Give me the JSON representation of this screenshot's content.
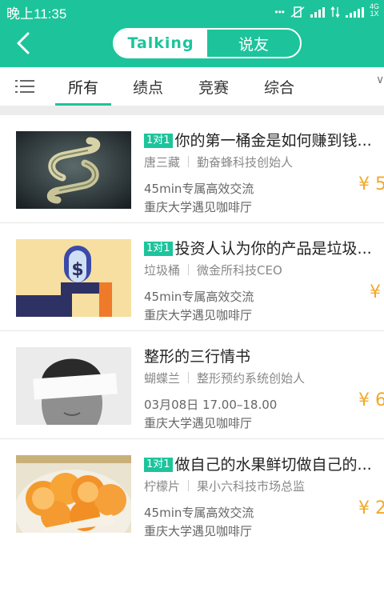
{
  "status": {
    "time": "晚上11:35",
    "dots": "•••",
    "net_label": "4G",
    "net_sub": "1X"
  },
  "header": {
    "tabs": [
      "Talking",
      "说友"
    ]
  },
  "category_tabs": [
    "所有",
    "绩点",
    "竞赛",
    "综合"
  ],
  "tab_more": "∨",
  "colors": {
    "accent": "#1dc49b",
    "price": "#f3a82a"
  },
  "cards": [
    {
      "badge": "1对1",
      "title": "你的第一桶金是如何赚到钱...",
      "name": "唐三藏",
      "role": "勤奋蜂科技创始人",
      "line1": "45min专属高效交流",
      "line2": "重庆大学遇见咖啡厅",
      "price": "¥ 5"
    },
    {
      "badge": "1对1",
      "title": "投资人认为你的产品是垃圾...",
      "name": "垃圾桶",
      "role": "微金所科技CEO",
      "line1": "45min专属高效交流",
      "line2": "重庆大学遇见咖啡厅",
      "price": "¥"
    },
    {
      "badge": "",
      "title": "整形的三行情书",
      "name": "蝴蝶兰",
      "role": "整形预约系统创始人",
      "line1": "03月08日 17.00–18.00",
      "line2": "重庆大学遇见咖啡厅",
      "price": "¥ 6"
    },
    {
      "badge": "1对1",
      "title": "做自己的水果鲜切做自己的...",
      "name": "柠檬片",
      "role": "果小六科技市场总监",
      "line1": "45min专属高效交流",
      "line2": "重庆大学遇见咖啡厅",
      "price": "¥ 2"
    }
  ]
}
